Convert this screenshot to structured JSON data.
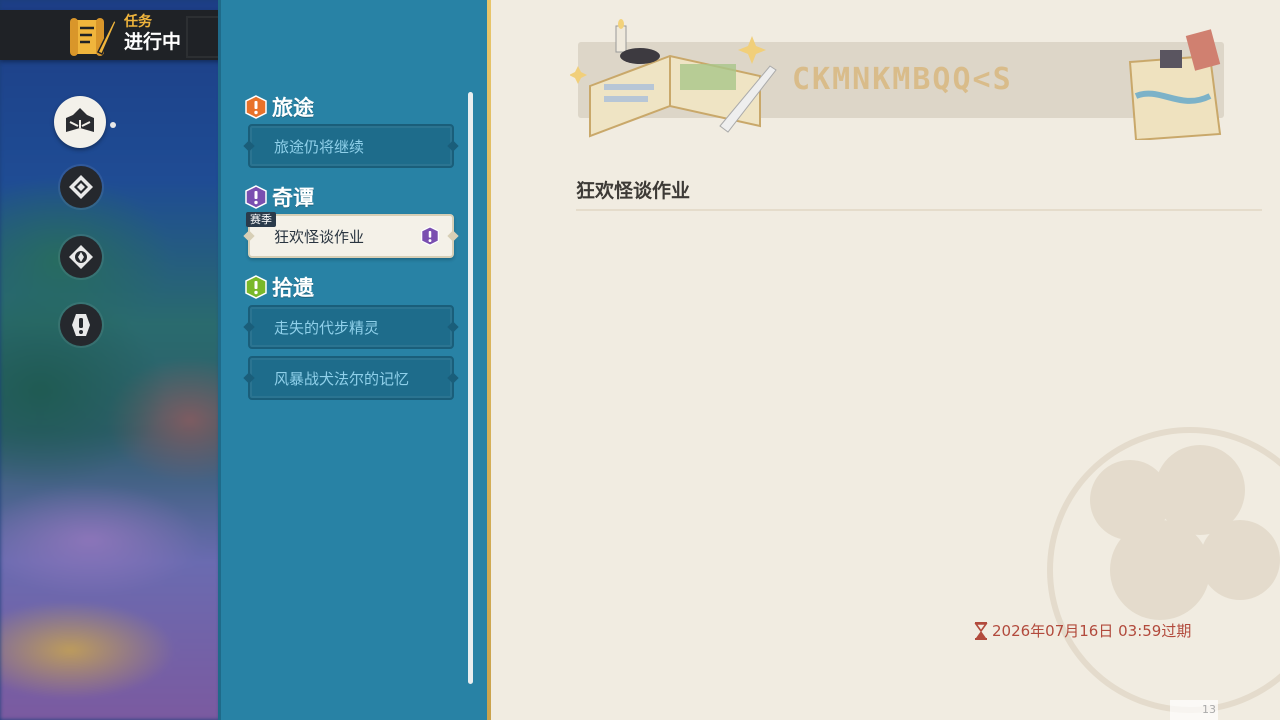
{
  "header": {
    "subtitle": "任务",
    "title": "进行中",
    "icon": "scroll-quill-icon"
  },
  "categories": [
    {
      "name": "book-icon",
      "active": true
    },
    {
      "name": "compass-diamond-icon",
      "active": false
    },
    {
      "name": "compass-diamond-alt-icon",
      "active": false
    },
    {
      "name": "exclamation-icon",
      "active": false
    }
  ],
  "sections": [
    {
      "label": "旅途",
      "badge_color": "#e8722a",
      "items": [
        {
          "label": "旅途仍将继续",
          "selected": false
        }
      ]
    },
    {
      "label": "奇谭",
      "badge_color": "#7a4fb0",
      "items": [
        {
          "label": "狂欢怪谈作业",
          "selected": true,
          "tag": "赛季",
          "badge_color": "#7a4fb0"
        }
      ]
    },
    {
      "label": "拾遗",
      "badge_color": "#7ab82a",
      "items": [
        {
          "label": "走失的代步精灵",
          "selected": false
        },
        {
          "label": "风暴战犬法尔的记忆",
          "selected": false
        }
      ]
    }
  ],
  "detail": {
    "banner_runes": "CKMNKMBQQ<S",
    "title": "狂欢怪谈作业",
    "expiry": "2026年07月16日 03:59过期",
    "corner_text": "13"
  },
  "colors": {
    "panel_blue": "#2882a5",
    "detail_bg": "#f1ece1",
    "accent_gold": "#e8c56a",
    "expiry_red": "#b24a3c"
  }
}
